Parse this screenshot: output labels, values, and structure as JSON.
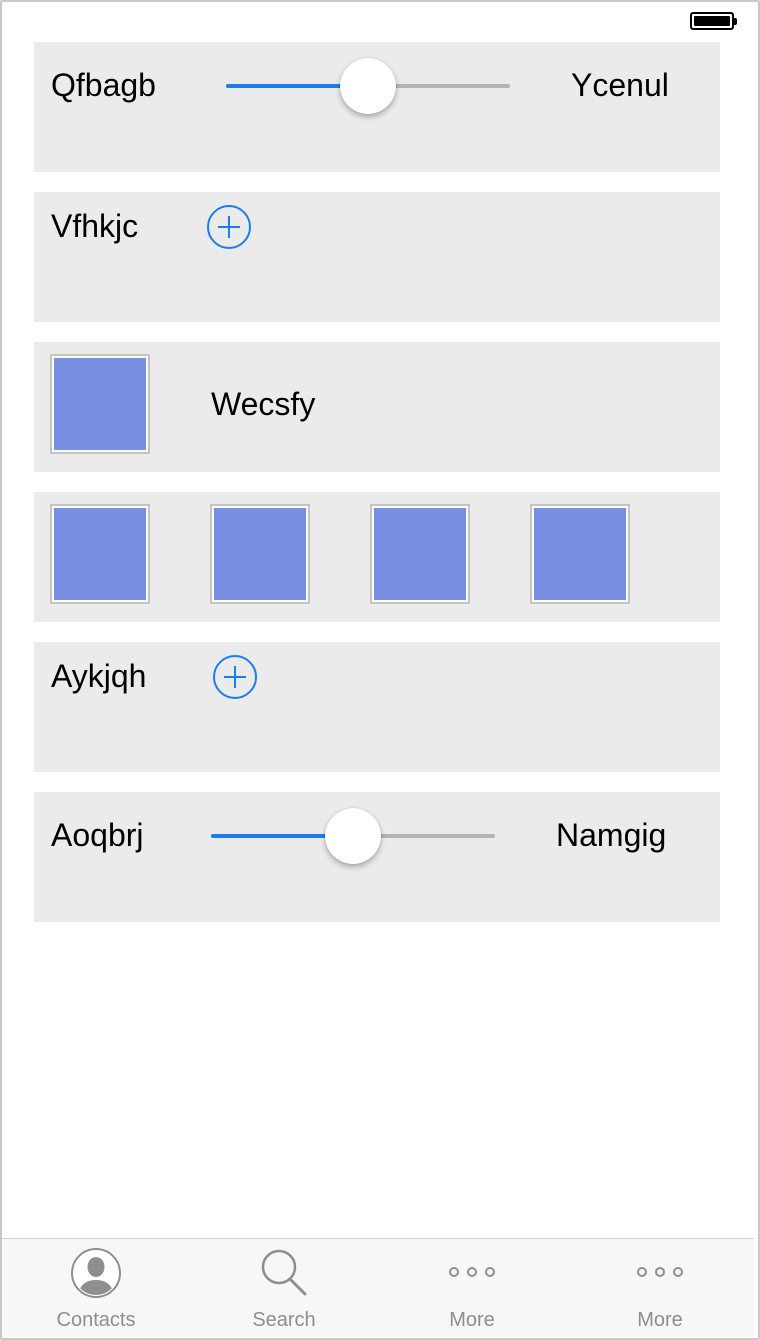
{
  "rows": [
    {
      "type": "slider",
      "left_label": "Qfbagb",
      "right_label": "Ycenul",
      "value": 0.5
    },
    {
      "type": "add",
      "label": "Vfhkjc"
    },
    {
      "type": "image-label",
      "label": "Wecsfy"
    },
    {
      "type": "images",
      "count": 4
    },
    {
      "type": "add",
      "label": "Aykjqh"
    },
    {
      "type": "slider",
      "left_label": "Aoqbrj",
      "right_label": "Namgig",
      "value": 0.5
    }
  ],
  "tabbar": {
    "tabs": [
      {
        "label": "Contacts",
        "icon": "contact-icon"
      },
      {
        "label": "Search",
        "icon": "search-icon"
      },
      {
        "label": "More",
        "icon": "more-icon"
      },
      {
        "label": "More",
        "icon": "more-icon"
      }
    ]
  },
  "colors": {
    "accent": "#1a7ef0",
    "row_bg": "#ebebeb",
    "image_fill": "#7890e4",
    "tab_label": "#8e8e8e"
  }
}
